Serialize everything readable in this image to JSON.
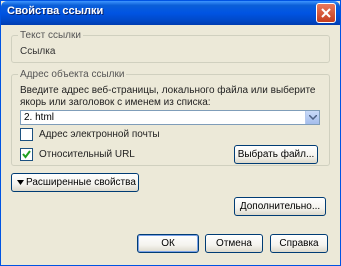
{
  "window": {
    "title": "Свойства ссылки"
  },
  "link_text_group": {
    "legend": "Текст ссылки",
    "value": "Ссылка"
  },
  "link_target_group": {
    "legend": "Адрес объекта ссылки",
    "description": "Введите адрес веб-страницы, локального файла или выберите якорь или заголовок с именем из списка:",
    "url_value": "2. html",
    "email_checkbox": {
      "label": "Адрес электронной почты",
      "checked": false
    },
    "relative_checkbox": {
      "label": "Относительный URL",
      "checked": true
    },
    "choose_file_label": "Выбрать файл..."
  },
  "advanced_toggle_label": "Расширенные свойства",
  "buttons": {
    "more": "Дополнительно...",
    "ok": "ОК",
    "cancel": "Отмена",
    "help": "Справка"
  },
  "icons": {
    "close": "close-icon",
    "dropdown": "chevron-down-icon",
    "expander": "triangle-down-icon",
    "check": "checkmark-icon"
  },
  "colors": {
    "titlebar": "#0054e3",
    "dialog_bg": "#ece9d8",
    "close_button": "#c53d1f",
    "checkmark": "#21a121"
  }
}
